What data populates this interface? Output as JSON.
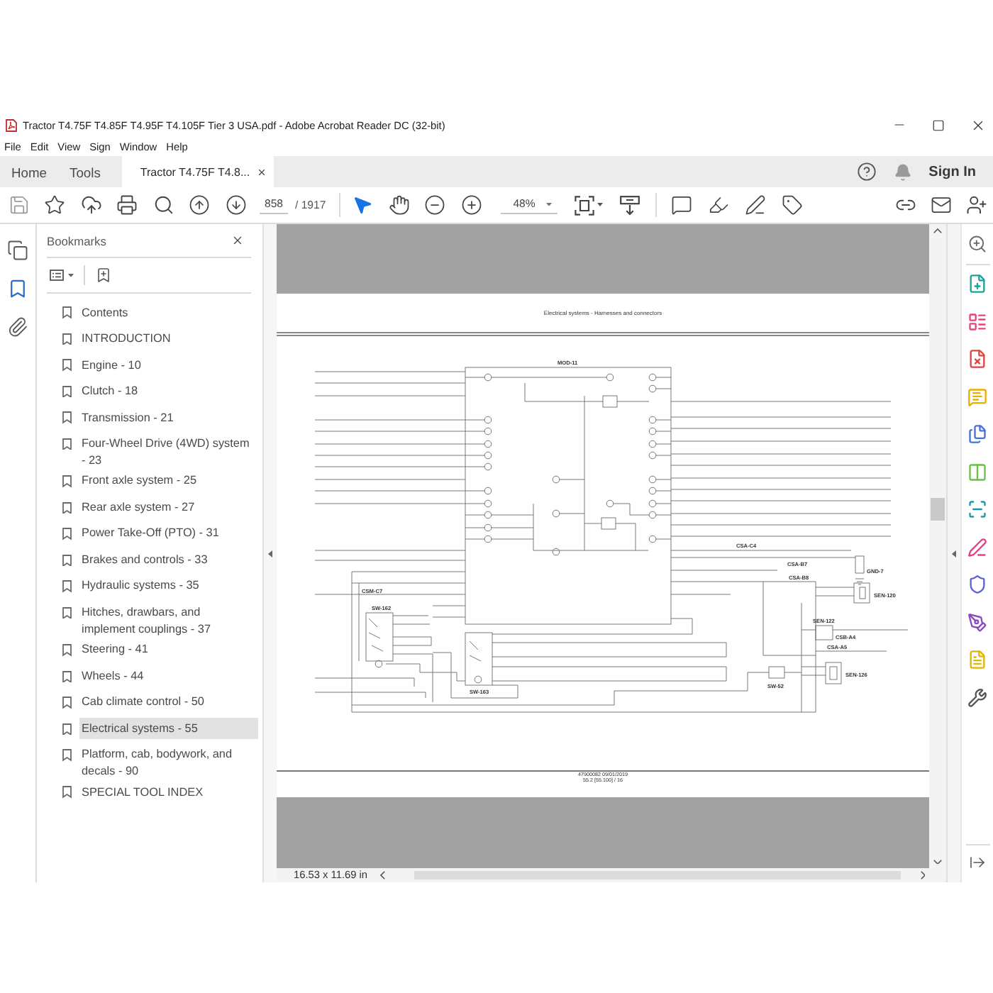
{
  "window": {
    "title": "Tractor T4.75F T4.85F T4.95F T4.105F Tier 3 USA.pdf - Adobe Acrobat Reader DC (32-bit)"
  },
  "menu": [
    "File",
    "Edit",
    "View",
    "Sign",
    "Window",
    "Help"
  ],
  "tabs": [
    {
      "label": "Home",
      "kind": "view",
      "selected": false
    },
    {
      "label": "Tools",
      "kind": "view",
      "selected": false
    },
    {
      "label": "Tractor T4.75F T4.8...",
      "kind": "document",
      "selected": true
    }
  ],
  "account": {
    "sign_in": "Sign In"
  },
  "toolbar": {
    "page": "858",
    "page_count": "/ 1917",
    "zoom": "48%"
  },
  "sidebar": {
    "panels": [
      {
        "kind": "pages",
        "selected": false
      },
      {
        "kind": "bookmarks",
        "selected": true
      },
      {
        "kind": "attachments",
        "selected": false
      }
    ]
  },
  "bookmarks": {
    "title": "Bookmarks",
    "items": [
      {
        "label": "Contents",
        "selected": false
      },
      {
        "label": "INTRODUCTION",
        "selected": false
      },
      {
        "label": "Engine - 10",
        "selected": false
      },
      {
        "label": "Clutch - 18",
        "selected": false
      },
      {
        "label": "Transmission - 21",
        "selected": false
      },
      {
        "label": "Four-Wheel Drive (4WD) system - 23",
        "selected": false
      },
      {
        "label": "Front axle system - 25",
        "selected": false
      },
      {
        "label": "Rear axle system - 27",
        "selected": false
      },
      {
        "label": "Power Take-Off (PTO) - 31",
        "selected": false
      },
      {
        "label": "Brakes and controls - 33",
        "selected": false
      },
      {
        "label": "Hydraulic systems - 35",
        "selected": false
      },
      {
        "label": "Hitches, drawbars, and implement couplings - 37",
        "selected": false
      },
      {
        "label": "Steering - 41",
        "selected": false
      },
      {
        "label": "Wheels - 44",
        "selected": false
      },
      {
        "label": "Cab climate control - 50",
        "selected": false
      },
      {
        "label": "Electrical systems - 55",
        "selected": true
      },
      {
        "label": "Platform, cab, bodywork, and decals - 90",
        "selected": false
      },
      {
        "label": "SPECIAL TOOL INDEX",
        "selected": false
      }
    ]
  },
  "document": {
    "page_title": "Electrical systems - Harnesses and connectors",
    "diagram_labels": [
      "MOD-11",
      "CSA-C4",
      "CSA-B7",
      "GND-7",
      "CSA-B8",
      "CSM-C7",
      "SEN-120",
      "SW-162",
      "SEN-122",
      "CSB-A4",
      "CSA-A5",
      "SEN-126",
      "SW-52",
      "SW-163"
    ],
    "footer": [
      "47900082 09/01/2019",
      "55.2 [55.100] / 16"
    ]
  },
  "status_bar": {
    "page_size": "16.53 x 11.69 in"
  }
}
